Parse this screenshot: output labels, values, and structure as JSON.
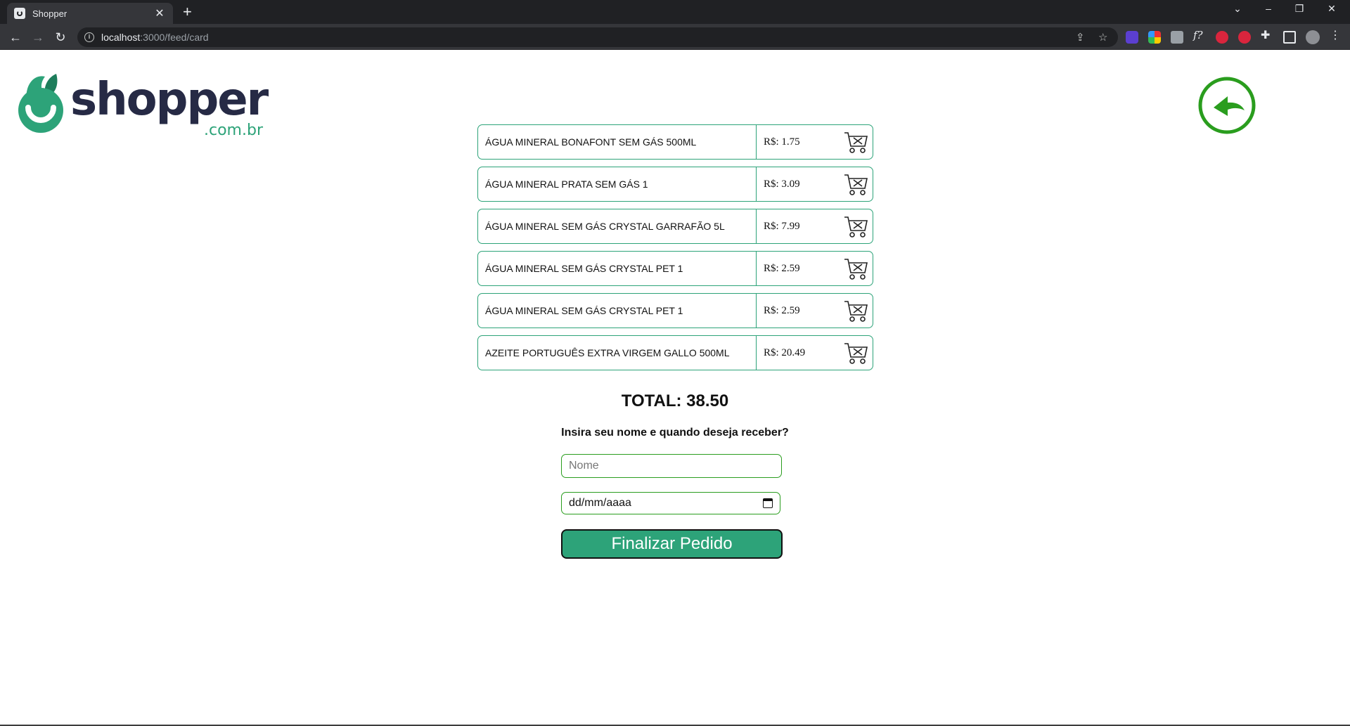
{
  "browser": {
    "tab_title": "Shopper",
    "tab_close": "✕",
    "new_tab": "+",
    "url_host": "localhost",
    "url_path": ":3000/feed/card",
    "window_controls": [
      "⌄",
      "–",
      "❐",
      "✕"
    ]
  },
  "brand": {
    "name": "shopper",
    "domain": ".com.br",
    "accent": "#2da379",
    "dark": "#262a45"
  },
  "cart": {
    "currency_prefix": "R$: ",
    "items": [
      {
        "name": "ÁGUA MINERAL BONAFONT SEM GÁS 500ML",
        "price": "R$: 1.75"
      },
      {
        "name": "ÁGUA MINERAL PRATA SEM GÁS 1",
        "price": "R$: 3.09"
      },
      {
        "name": "ÁGUA MINERAL SEM GÁS CRYSTAL GARRAFÃO 5L",
        "price": "R$: 7.99"
      },
      {
        "name": "ÁGUA MINERAL SEM GÁS CRYSTAL PET 1",
        "price": "R$: 2.59"
      },
      {
        "name": "ÁGUA MINERAL SEM GÁS CRYSTAL PET 1",
        "price": "R$: 2.59"
      },
      {
        "name": "AZEITE PORTUGUÊS EXTRA VIRGEM GALLO 500ML",
        "price": "R$: 20.49"
      }
    ],
    "total_label": "TOTAL: 38.50"
  },
  "form": {
    "prompt": "Insira seu nome e quando deseja receber?",
    "name_placeholder": "Nome",
    "date_placeholder": "dd/mm/aaaa",
    "submit_label": "Finalizar Pedido"
  }
}
